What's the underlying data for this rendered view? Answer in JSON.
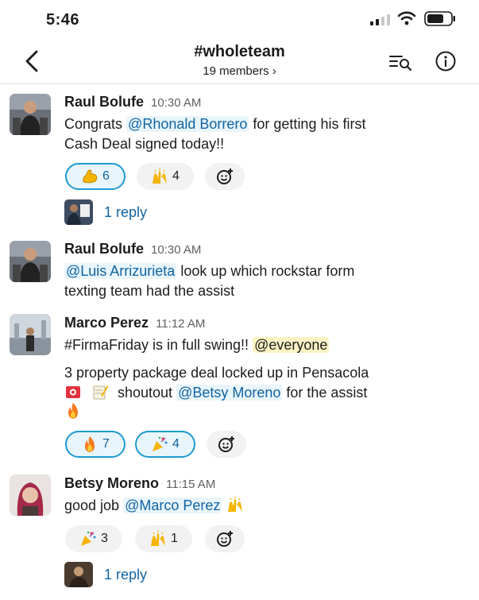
{
  "status": {
    "time": "5:46"
  },
  "header": {
    "channel": "#wholeteam",
    "members": "19 members ›"
  },
  "messages": [
    {
      "author": "Raul Bolufe",
      "time": "10:30 AM",
      "line1_pre": "Congrats ",
      "line1_mention": "@Rhonald Borrero",
      "line1_post": " for getting his first",
      "line2": "Cash Deal signed today!!",
      "reactions": [
        {
          "emoji": "flexed-biceps",
          "count": "6",
          "mine": true
        },
        {
          "emoji": "raising-hands",
          "count": "4",
          "mine": false
        }
      ],
      "reply_text": "1 reply"
    },
    {
      "author": "Raul Bolufe",
      "time": "10:30 AM",
      "line1_mention": "@Luis Arrizurieta",
      "line1_post": " look up which rockstar form",
      "line2": "texting team had the assist"
    },
    {
      "author": "Marco Perez",
      "time": "11:12 AM",
      "line1_pre": "#FirmaFriday is in full swing!! ",
      "line1_mention": "@everyone",
      "line2": "3 property package deal locked up in Pensacola",
      "line3_pre": " shoutout ",
      "line3_mention": "@Betsy Moreno",
      "line3_post": " for the assist",
      "reactions": [
        {
          "emoji": "fire",
          "count": "7",
          "mine": true
        },
        {
          "emoji": "party-popper",
          "count": "4",
          "mine": true
        }
      ]
    },
    {
      "author": "Betsy Moreno",
      "time": "11:15 AM",
      "line1_pre": "good job ",
      "line1_mention": "@Marco Perez",
      "reactions": [
        {
          "emoji": "party-popper",
          "count": "3",
          "mine": false
        },
        {
          "emoji": "raising-hands",
          "count": "1",
          "mine": false
        }
      ],
      "reply_text": "1 reply"
    }
  ],
  "colors": {
    "link": "#1264a3",
    "mention_bg": "#e8f5fa",
    "selected_border": "#1d9bd1",
    "everyone_bg": "#fcf3c4"
  }
}
